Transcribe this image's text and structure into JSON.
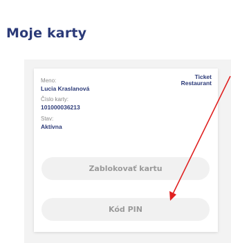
{
  "page": {
    "title": "Moje karty"
  },
  "card": {
    "brand_line1": "Ticket",
    "brand_line2": "Restaurant",
    "name_label": "Meno:",
    "name_value": "Lucia Kraslanová",
    "number_label": "Číslo karty:",
    "number_value": "101000036213",
    "status_label": "Stav:",
    "status_value": "Aktívna"
  },
  "actions": {
    "block_label": "Zablokovať kartu",
    "pin_label": "Kód PIN"
  },
  "colors": {
    "title": "#2b3a78",
    "annotation_arrow": "#e02020"
  }
}
